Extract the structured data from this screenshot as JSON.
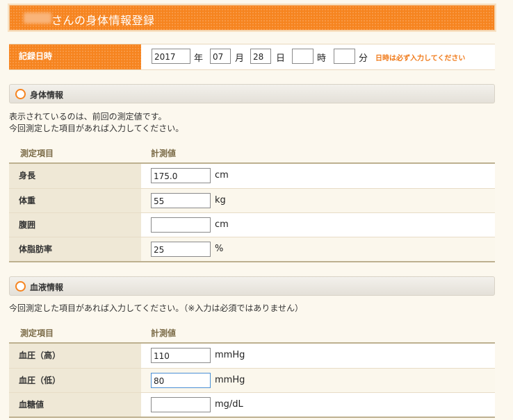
{
  "title": "さんの身体情報登録",
  "record": {
    "label": "記録日時",
    "year": "2017",
    "year_unit": "年",
    "month": "07",
    "month_unit": "月",
    "day": "28",
    "day_unit": "日",
    "hour": "",
    "hour_unit": "時",
    "minute": "",
    "minute_unit": "分",
    "note": "日時は必ず入力してください"
  },
  "body_section": {
    "title": "身体情報",
    "desc1": "表示されているのは、前回の測定値です。",
    "desc2": "今回測定した項目があれば入力してください。",
    "col_item": "測定項目",
    "col_value": "計測値",
    "rows": [
      {
        "label": "身長",
        "value": "175.0",
        "unit": "cm"
      },
      {
        "label": "体重",
        "value": "55",
        "unit": "kg"
      },
      {
        "label": "腹囲",
        "value": "",
        "unit": "cm"
      },
      {
        "label": "体脂肪率",
        "value": "25",
        "unit": "%"
      }
    ]
  },
  "blood_section": {
    "title": "血液情報",
    "desc": "今回測定した項目があれば入力してください。（※入力は必須ではありません）",
    "col_item": "測定項目",
    "col_value": "計測値",
    "rows": [
      {
        "label": "血圧（高）",
        "value": "110",
        "unit": "mmHg"
      },
      {
        "label": "血圧（低）",
        "value": "80",
        "unit": "mmHg"
      },
      {
        "label": "血糖値",
        "value": "",
        "unit": "mg/dL"
      }
    ]
  },
  "colors": {
    "accent": "#f6841f",
    "label_bg": "#efe8d6",
    "note": "#f07a1a"
  }
}
